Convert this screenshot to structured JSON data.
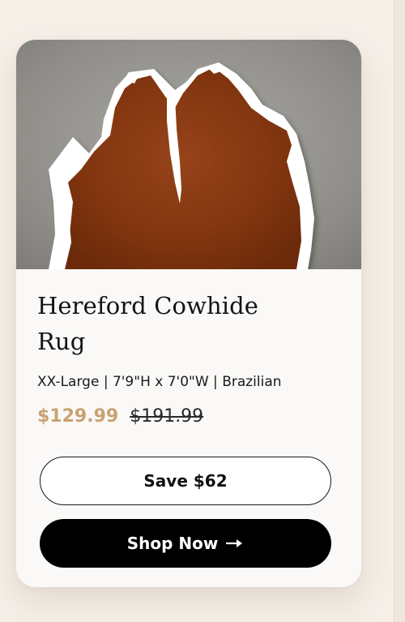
{
  "product": {
    "title": "Hereford Cowhide Rug",
    "details": "XX-Large | 7'9\"H x 7'0\"W | Brazilian",
    "sale_price": "$129.99",
    "original_price": "$191.99",
    "image_alt": "Hereford Cowhide Rug"
  },
  "buttons": {
    "save_label": "Save $62",
    "shop_label": "Shop Now",
    "shop_icon": "arrow-right-icon"
  },
  "colors": {
    "page_background": "#f5efe8",
    "card_background": "#fbf9f7",
    "sale_price": "#c8a272",
    "primary_button": "#000000",
    "hide_brown": "#8a3a12",
    "hide_white": "#ffffff"
  }
}
